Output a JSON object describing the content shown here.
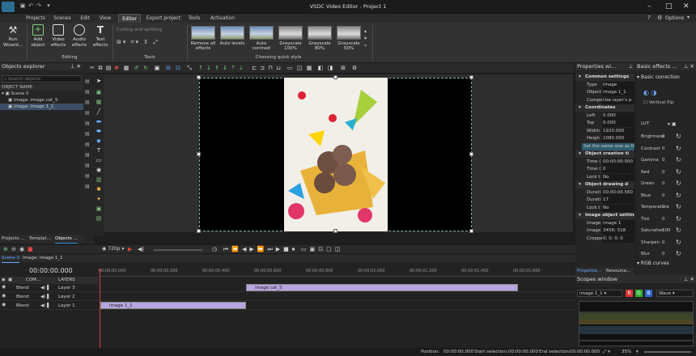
{
  "window": {
    "title": "VSDC Video Editor - Project 1"
  },
  "menu": {
    "tabs": [
      "Projects",
      "Scenes",
      "Edit",
      "View",
      "Editor",
      "Export project",
      "Tools",
      "Activation"
    ],
    "active": "Editor",
    "right": [
      "Options"
    ]
  },
  "ribbon": {
    "run_wizard": "Run Wizard...",
    "add_object": "Add object",
    "video_effects": "Video effects",
    "audio_effects": "Audio effects",
    "text_effects": "Text effects",
    "editing_label": "Editing",
    "cutting": "Cutting and splitting",
    "tools_label": "Tools",
    "effects": [
      "Remove all effects",
      "Auto levels",
      "Auto contrast",
      "Grayscale 100%",
      "Grayscale 80%",
      "Grayscale 50%"
    ],
    "quick_style_label": "Choosing quick style"
  },
  "objects_explorer": {
    "title": "Objects explorer",
    "search_placeholder": "Search objects",
    "column": "OBJECT NAME",
    "items": [
      "Scene 0",
      "Image: image cat_5",
      "Image: image 1_1"
    ],
    "bottom_tabs": [
      "Projects ...",
      "Templat...",
      "Objects ..."
    ]
  },
  "properties": {
    "title": "Properties wi...",
    "rows": [
      {
        "k": "Common settings",
        "v": "",
        "section": true
      },
      {
        "k": "Type",
        "v": "Image"
      },
      {
        "k": "Object n",
        "v": "image 1_1"
      },
      {
        "k": "Compos",
        "v": "Use layer's p"
      },
      {
        "k": "Coordinates",
        "v": "",
        "section": true
      },
      {
        "k": "Left",
        "v": "0.000"
      },
      {
        "k": "Top",
        "v": "0.000"
      },
      {
        "k": "Width",
        "v": "1920.000"
      },
      {
        "k": "Heigh",
        "v": "1080.000"
      },
      {
        "k": "Set the same size as th...",
        "v": "",
        "note": true
      },
      {
        "k": "Object creation ti",
        "v": "",
        "section": true
      },
      {
        "k": "Time (",
        "v": "00:00:00.000"
      },
      {
        "k": "Time (",
        "v": "0"
      },
      {
        "k": "Lock t",
        "v": "No"
      },
      {
        "k": "Object drawing d",
        "v": "",
        "section": true
      },
      {
        "k": "Durati",
        "v": "00:00:00.560"
      },
      {
        "k": "Durati",
        "v": "17"
      },
      {
        "k": "Lock t",
        "v": "No"
      },
      {
        "k": "Image object setting",
        "v": "",
        "section": true
      },
      {
        "k": "Image",
        "v": "image 1"
      },
      {
        "k": "Image si",
        "v": "3456; 518"
      },
      {
        "k": "Cropped",
        "v": "0; 0; 0; 0"
      }
    ],
    "bottom_tabs": [
      "Propertie...",
      "Resource..."
    ]
  },
  "basic_effects": {
    "title": "Basic effects ...",
    "section": "Basic correction",
    "vertical_flip": "Vertical flip",
    "lut": "LUT",
    "params": [
      {
        "n": "Brightness",
        "v": "0"
      },
      {
        "n": "Contrast",
        "v": "0"
      },
      {
        "n": "Gamma",
        "v": "0"
      },
      {
        "n": "Red",
        "v": "0"
      },
      {
        "n": "Green",
        "v": "0"
      },
      {
        "n": "Blue",
        "v": "0"
      },
      {
        "n": "Temperature",
        "v": "0"
      },
      {
        "n": "Tint",
        "v": "0"
      },
      {
        "n": "Saturation",
        "v": "100"
      },
      {
        "n": "Sharpen",
        "v": "0"
      },
      {
        "n": "Blur",
        "v": "0"
      }
    ],
    "rgb_curves": "RGB curves"
  },
  "playbar": {
    "quality": "720p"
  },
  "timeline": {
    "scene_tab": "Scene 0",
    "object_tab": "Image: image 1_1",
    "time": "00:00:00.000",
    "com_label": "COM...",
    "layers_label": "LAYERS",
    "ruler": [
      "00:00:00.000",
      "00:00:00.200",
      "00:00:00.400",
      "00:00:00.600",
      "00:00:00.800",
      "00:00:01.000",
      "00:00:01.200",
      "00:00:01.400",
      "00:00:01.600"
    ],
    "tracks": [
      {
        "blend": "Blend",
        "name": "Layer 3",
        "clip": "image cat_5"
      },
      {
        "blend": "Blend",
        "name": "Layer 2",
        "clip": ""
      },
      {
        "blend": "Blend",
        "name": "Layer 1",
        "clip": "image 1_1"
      }
    ]
  },
  "scopes": {
    "title": "Scopes window",
    "source": "image 1_1",
    "channels": [
      "R",
      "G",
      "B"
    ],
    "mode": "Wave"
  },
  "status": {
    "position_label": "Position:",
    "position": "00:00:00.000",
    "start_label": "Start selection:",
    "start": "00:00:00.000",
    "end_label": "End selection:",
    "end": "00:00:00.000",
    "zoom": "35%"
  },
  "colors": {
    "accent": "#1e90d6",
    "clip": "#b7a6e0",
    "playhead": "#d43c3c",
    "selection": "#3d4f66"
  }
}
